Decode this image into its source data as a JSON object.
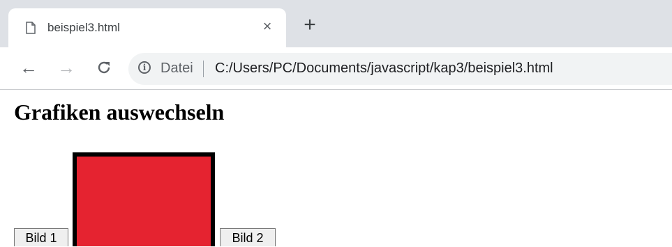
{
  "browser": {
    "tab": {
      "title": "beispiel3.html",
      "page_icon": "document-icon",
      "close_glyph": "×"
    },
    "new_tab_glyph": "+",
    "toolbar": {
      "back_glyph": "←",
      "forward_glyph": "→",
      "reload_glyph": "C",
      "info_glyph": "i",
      "security_label": "Datei",
      "url": "C:/Users/PC/Documents/javascript/kap3/beispiel3.html"
    }
  },
  "page": {
    "heading": "Grafiken auswechseln",
    "buttons": {
      "bild1": "Bild 1",
      "bild2": "Bild 2"
    },
    "image": {
      "fill_color": "#e52330",
      "border_color": "#000000"
    }
  },
  "colors": {
    "tabstrip": "#dee1e6",
    "omnibox": "#f1f3f4"
  }
}
